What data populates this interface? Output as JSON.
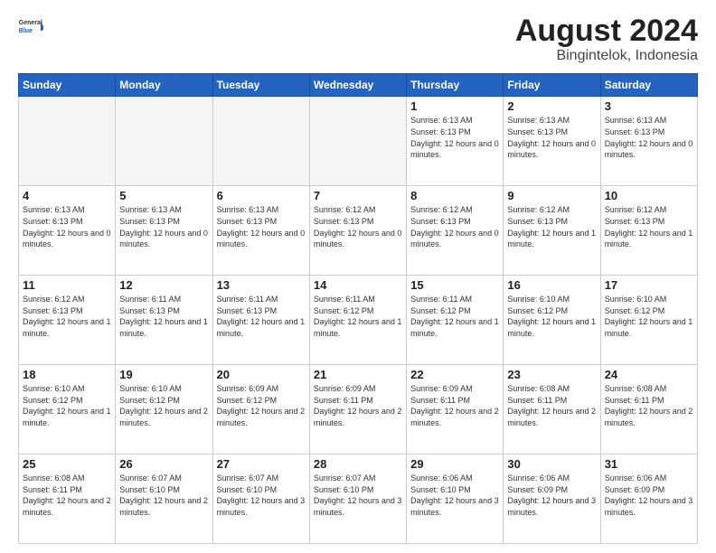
{
  "logo": {
    "general": "General",
    "blue": "Blue"
  },
  "title": "August 2024",
  "subtitle": "Bingintelok, Indonesia",
  "days_of_week": [
    "Sunday",
    "Monday",
    "Tuesday",
    "Wednesday",
    "Thursday",
    "Friday",
    "Saturday"
  ],
  "weeks": [
    [
      {
        "day": "",
        "info": ""
      },
      {
        "day": "",
        "info": ""
      },
      {
        "day": "",
        "info": ""
      },
      {
        "day": "",
        "info": ""
      },
      {
        "day": "1",
        "info": "Sunrise: 6:13 AM\nSunset: 6:13 PM\nDaylight: 12 hours and 0 minutes."
      },
      {
        "day": "2",
        "info": "Sunrise: 6:13 AM\nSunset: 6:13 PM\nDaylight: 12 hours and 0 minutes."
      },
      {
        "day": "3",
        "info": "Sunrise: 6:13 AM\nSunset: 6:13 PM\nDaylight: 12 hours and 0 minutes."
      }
    ],
    [
      {
        "day": "4",
        "info": "Sunrise: 6:13 AM\nSunset: 6:13 PM\nDaylight: 12 hours and 0 minutes."
      },
      {
        "day": "5",
        "info": "Sunrise: 6:13 AM\nSunset: 6:13 PM\nDaylight: 12 hours and 0 minutes."
      },
      {
        "day": "6",
        "info": "Sunrise: 6:13 AM\nSunset: 6:13 PM\nDaylight: 12 hours and 0 minutes."
      },
      {
        "day": "7",
        "info": "Sunrise: 6:12 AM\nSunset: 6:13 PM\nDaylight: 12 hours and 0 minutes."
      },
      {
        "day": "8",
        "info": "Sunrise: 6:12 AM\nSunset: 6:13 PM\nDaylight: 12 hours and 0 minutes."
      },
      {
        "day": "9",
        "info": "Sunrise: 6:12 AM\nSunset: 6:13 PM\nDaylight: 12 hours and 1 minute."
      },
      {
        "day": "10",
        "info": "Sunrise: 6:12 AM\nSunset: 6:13 PM\nDaylight: 12 hours and 1 minute."
      }
    ],
    [
      {
        "day": "11",
        "info": "Sunrise: 6:12 AM\nSunset: 6:13 PM\nDaylight: 12 hours and 1 minute."
      },
      {
        "day": "12",
        "info": "Sunrise: 6:11 AM\nSunset: 6:13 PM\nDaylight: 12 hours and 1 minute."
      },
      {
        "day": "13",
        "info": "Sunrise: 6:11 AM\nSunset: 6:13 PM\nDaylight: 12 hours and 1 minute."
      },
      {
        "day": "14",
        "info": "Sunrise: 6:11 AM\nSunset: 6:12 PM\nDaylight: 12 hours and 1 minute."
      },
      {
        "day": "15",
        "info": "Sunrise: 6:11 AM\nSunset: 6:12 PM\nDaylight: 12 hours and 1 minute."
      },
      {
        "day": "16",
        "info": "Sunrise: 6:10 AM\nSunset: 6:12 PM\nDaylight: 12 hours and 1 minute."
      },
      {
        "day": "17",
        "info": "Sunrise: 6:10 AM\nSunset: 6:12 PM\nDaylight: 12 hours and 1 minute."
      }
    ],
    [
      {
        "day": "18",
        "info": "Sunrise: 6:10 AM\nSunset: 6:12 PM\nDaylight: 12 hours and 1 minute."
      },
      {
        "day": "19",
        "info": "Sunrise: 6:10 AM\nSunset: 6:12 PM\nDaylight: 12 hours and 2 minutes."
      },
      {
        "day": "20",
        "info": "Sunrise: 6:09 AM\nSunset: 6:12 PM\nDaylight: 12 hours and 2 minutes."
      },
      {
        "day": "21",
        "info": "Sunrise: 6:09 AM\nSunset: 6:11 PM\nDaylight: 12 hours and 2 minutes."
      },
      {
        "day": "22",
        "info": "Sunrise: 6:09 AM\nSunset: 6:11 PM\nDaylight: 12 hours and 2 minutes."
      },
      {
        "day": "23",
        "info": "Sunrise: 6:08 AM\nSunset: 6:11 PM\nDaylight: 12 hours and 2 minutes."
      },
      {
        "day": "24",
        "info": "Sunrise: 6:08 AM\nSunset: 6:11 PM\nDaylight: 12 hours and 2 minutes."
      }
    ],
    [
      {
        "day": "25",
        "info": "Sunrise: 6:08 AM\nSunset: 6:11 PM\nDaylight: 12 hours and 2 minutes."
      },
      {
        "day": "26",
        "info": "Sunrise: 6:07 AM\nSunset: 6:10 PM\nDaylight: 12 hours and 2 minutes."
      },
      {
        "day": "27",
        "info": "Sunrise: 6:07 AM\nSunset: 6:10 PM\nDaylight: 12 hours and 3 minutes."
      },
      {
        "day": "28",
        "info": "Sunrise: 6:07 AM\nSunset: 6:10 PM\nDaylight: 12 hours and 3 minutes."
      },
      {
        "day": "29",
        "info": "Sunrise: 6:06 AM\nSunset: 6:10 PM\nDaylight: 12 hours and 3 minutes."
      },
      {
        "day": "30",
        "info": "Sunrise: 6:06 AM\nSunset: 6:09 PM\nDaylight: 12 hours and 3 minutes."
      },
      {
        "day": "31",
        "info": "Sunrise: 6:06 AM\nSunset: 6:09 PM\nDaylight: 12 hours and 3 minutes."
      }
    ]
  ]
}
